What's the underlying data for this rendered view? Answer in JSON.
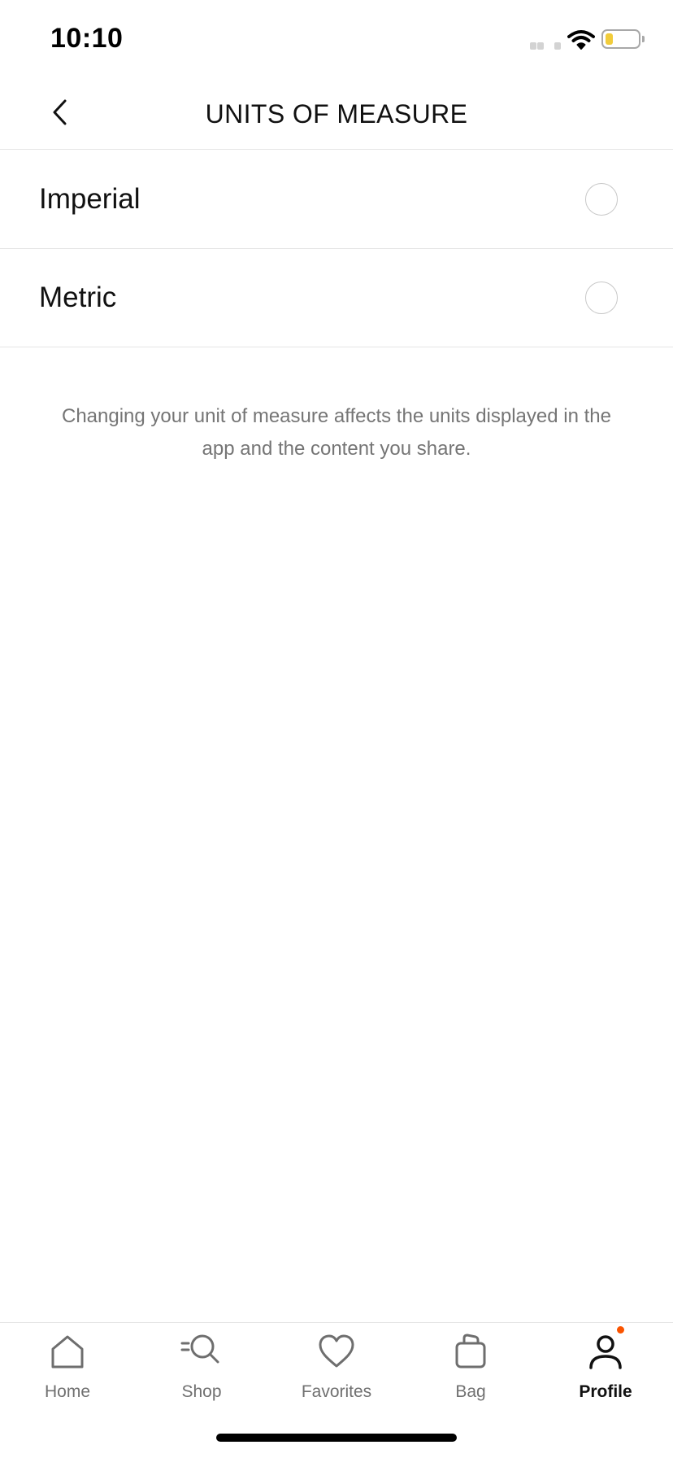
{
  "status_bar": {
    "time": "10:10"
  },
  "header": {
    "title": "UNITS OF MEASURE",
    "back_icon": "chevron-left-icon"
  },
  "options": [
    {
      "label": "Imperial",
      "selected": false
    },
    {
      "label": "Metric",
      "selected": false
    }
  ],
  "note": "Changing your unit of measure affects the units displayed in the app and the content you share.",
  "tab_bar": {
    "tabs": [
      {
        "label": "Home",
        "icon": "home-icon",
        "active": false
      },
      {
        "label": "Shop",
        "icon": "shop-search-icon",
        "active": false
      },
      {
        "label": "Favorites",
        "icon": "heart-icon",
        "active": false
      },
      {
        "label": "Bag",
        "icon": "bag-icon",
        "active": false
      },
      {
        "label": "Profile",
        "icon": "profile-icon",
        "active": true
      }
    ]
  },
  "colors": {
    "notification_dot": "#fa5400",
    "battery_fill": "#f1cc3b",
    "active_tab": "#111111",
    "inactive_tab": "#707070"
  }
}
